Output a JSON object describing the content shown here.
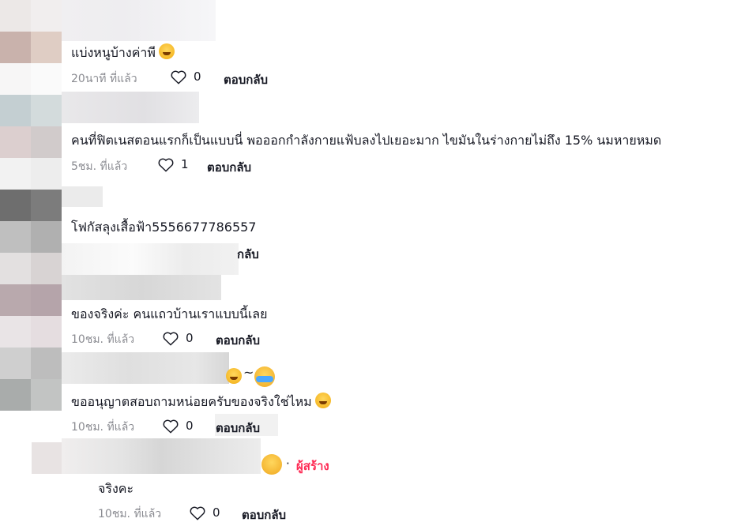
{
  "comments": [
    {
      "text": "แบ่งหนูบ้างค่าพี",
      "emoji": "grinning-sweat-emoji",
      "time": "20นาที ที่แล้ว",
      "likes": "0",
      "reply_label": "ตอบกลับ"
    },
    {
      "text": "คนที่ฟิตเนสตอนแรกก็เป็นแบบนี่ พอออกกำลังกายแฟ้บลงไปเยอะมาก ไขมันในร่างกายไม่ถึง 15% นมหายหมด",
      "time": "5ชม. ที่แล้ว",
      "likes": "1",
      "reply_label": "ตอบกลับ"
    },
    {
      "text": "โฟกัสลุงเสื้อฟ้า5556677786557",
      "reply_label_partial": "กลับ"
    },
    {
      "text": "ของจริงค่ะ คนแถวบ้านเราแบบนี้เลย",
      "time": "10ชม. ที่แล้ว",
      "likes": "0",
      "reply_label": "ตอบกลับ"
    },
    {
      "text": "ขออนุญาตสอบถามหน่อยครับของจริงใช่ไหม",
      "emoji": "sweat-smile-emoji",
      "time": "10ชม. ที่แล้ว",
      "likes": "0",
      "reply_label": "ตอบกลับ",
      "name_suffix": "~"
    }
  ],
  "creator_reply": {
    "badge": "ผู้สร้าง",
    "separator": "·",
    "text": "จริงคะ",
    "time": "10ชม. ที่แล้ว",
    "likes": "0",
    "reply_label": "ตอบกลับ"
  },
  "colors": {
    "creator_badge": "#fe2c55",
    "meta_text": "#8a8b91",
    "primary_text": "#161823"
  }
}
